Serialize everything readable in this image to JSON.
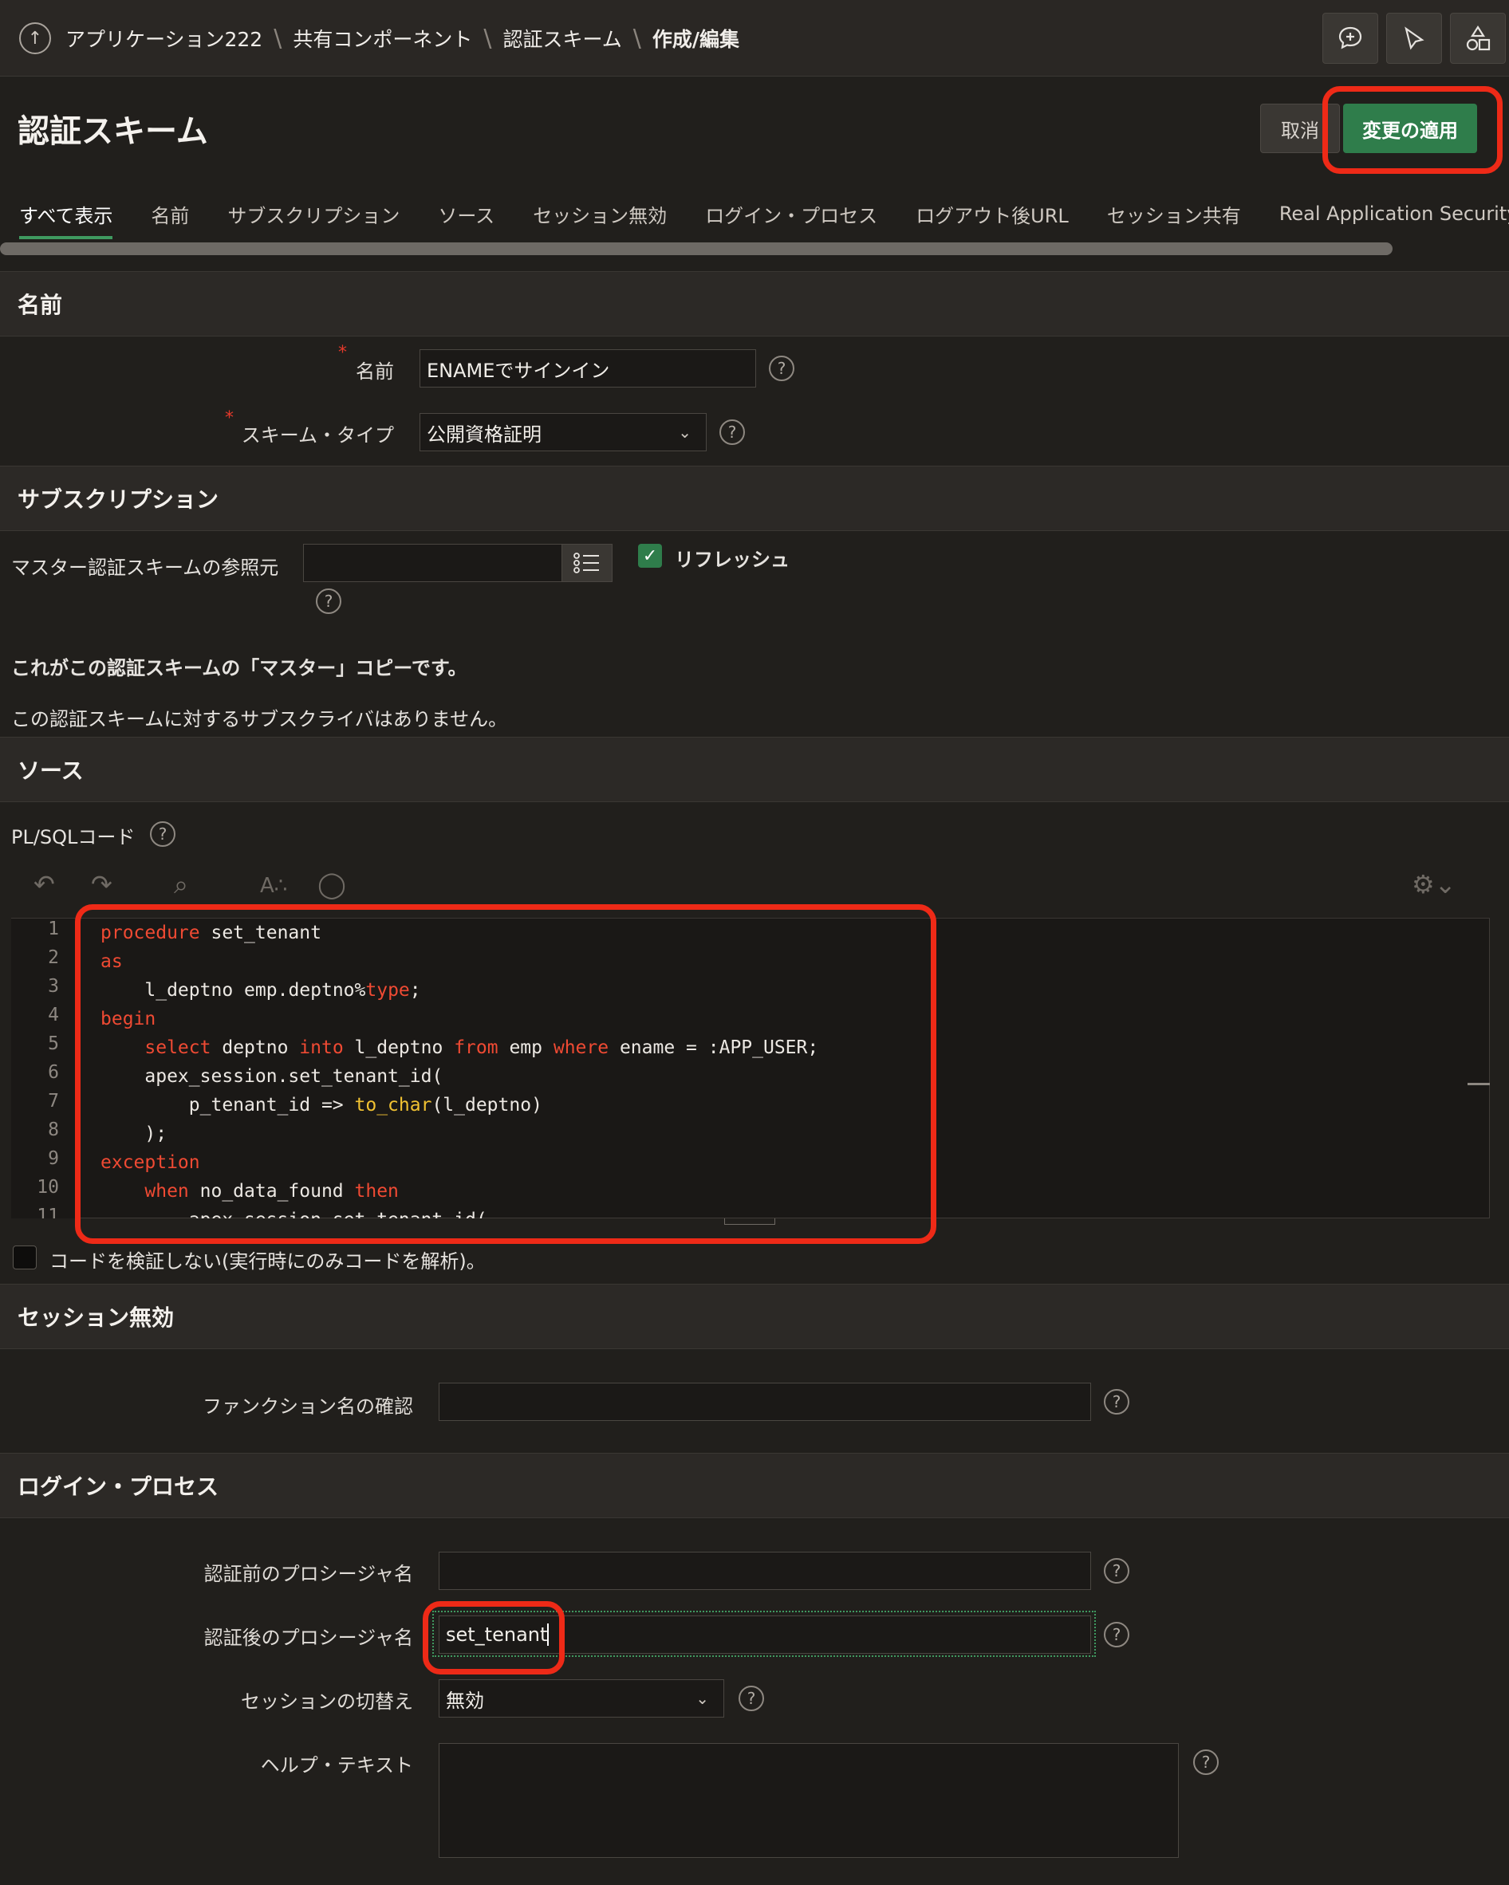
{
  "breadcrumb": [
    "アプリケーション222",
    "共有コンポーネント",
    "認証スキーム",
    "作成/編集"
  ],
  "header": {
    "title": "認証スキーム",
    "cancel_label": "取消",
    "apply_label": "変更の適用"
  },
  "tabs": [
    "すべて表示",
    "名前",
    "サブスクリプション",
    "ソース",
    "セッション無効",
    "ログイン・プロセス",
    "ログアウト後URL",
    "セッション共有",
    "Real Application Security"
  ],
  "sections": {
    "name": {
      "title": "名前",
      "name_label": "名前",
      "name_value": "ENAMEでサインイン",
      "scheme_type_label": "スキーム・タイプ",
      "scheme_type_value": "公開資格証明"
    },
    "subscription": {
      "title": "サブスクリプション",
      "master_label": "マスター認証スキームの参照元",
      "master_value": "",
      "refresh_label": "リフレッシュ",
      "master_copy_note": "これがこの認証スキームの「マスター」コピーです。",
      "no_subscribers_note": "この認証スキームに対するサブスクライバはありません。"
    },
    "source": {
      "title": "ソース",
      "code_label": "PL/SQLコード",
      "line_numbers": [
        "1",
        "2",
        "3",
        "4",
        "5",
        "6",
        "7",
        "8",
        "9",
        "10",
        "11"
      ],
      "code_lines": [
        "procedure set_tenant",
        "as",
        "    l_deptno emp.deptno%type;",
        "begin",
        "    select deptno into l_deptno from emp where ename = :APP_USER;",
        "    apex_session.set_tenant_id(",
        "        p_tenant_id => to_char(l_deptno)",
        "    );",
        "exception",
        "    when no_data_found then",
        "        apex_session.set_tenant_id("
      ],
      "no_validate_label": "コードを検証しない(実行時にのみコードを解析)。"
    },
    "session_invalid": {
      "title": "セッション無効",
      "verify_function_label": "ファンクション名の確認",
      "verify_function_value": ""
    },
    "login_process": {
      "title": "ログイン・プロセス",
      "pre_auth_label": "認証前のプロシージャ名",
      "pre_auth_value": "",
      "post_auth_label": "認証後のプロシージャ名",
      "post_auth_value": "set_tenant",
      "switch_session_label": "セッションの切替え",
      "switch_session_value": "無効",
      "help_text_label": "ヘルプ・テキスト",
      "help_text_value": ""
    }
  },
  "colors": {
    "accent": "#2f7d4b",
    "highlight": "#ee2a17",
    "keyword": "#ef4a33",
    "function": "#f1c232"
  }
}
